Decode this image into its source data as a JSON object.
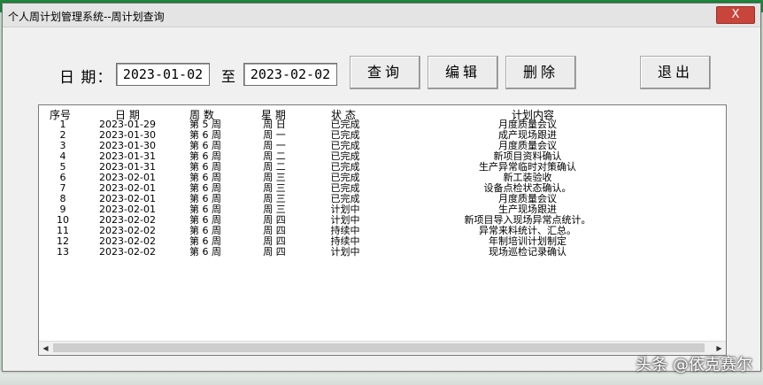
{
  "window": {
    "title": "个人周计划管理系统--周计划查询",
    "close_label": "X"
  },
  "filter": {
    "date_label": "日 期：",
    "start_date": "2023-01-02",
    "to_label": "至",
    "end_date": "2023-02-02"
  },
  "buttons": {
    "query": "查询",
    "edit": "编辑",
    "delete": "删除",
    "exit": "退出"
  },
  "table": {
    "headers": {
      "seq": "序号",
      "date": "日 期",
      "week": "周 数",
      "weekday": "星 期",
      "status": "状 态",
      "content": "计划内容"
    },
    "rows": [
      {
        "seq": "1",
        "date": "2023-01-29",
        "week": "第 5 周",
        "weekday": "周 日",
        "status": "已完成",
        "content": "月度质量会议"
      },
      {
        "seq": "2",
        "date": "2023-01-30",
        "week": "第 6 周",
        "weekday": "周 一",
        "status": "已完成",
        "content": "成产现场跟进"
      },
      {
        "seq": "3",
        "date": "2023-01-30",
        "week": "第 6 周",
        "weekday": "周 一",
        "status": "已完成",
        "content": "月度质量会议"
      },
      {
        "seq": "4",
        "date": "2023-01-31",
        "week": "第 6 周",
        "weekday": "周 二",
        "status": "已完成",
        "content": "新项目资料确认"
      },
      {
        "seq": "5",
        "date": "2023-01-31",
        "week": "第 6 周",
        "weekday": "周 二",
        "status": "已完成",
        "content": "生产异常临时对策确认"
      },
      {
        "seq": "6",
        "date": "2023-02-01",
        "week": "第 6 周",
        "weekday": "周 三",
        "status": "已完成",
        "content": "新工装验收"
      },
      {
        "seq": "7",
        "date": "2023-02-01",
        "week": "第 6 周",
        "weekday": "周 三",
        "status": "已完成",
        "content": "设备点检状态确认。"
      },
      {
        "seq": "8",
        "date": "2023-02-01",
        "week": "第 6 周",
        "weekday": "周 三",
        "status": "已完成",
        "content": "月度质量会议"
      },
      {
        "seq": "9",
        "date": "2023-02-01",
        "week": "第 6 周",
        "weekday": "周 三",
        "status": "计划中",
        "content": "生产现场跟进"
      },
      {
        "seq": "10",
        "date": "2023-02-02",
        "week": "第 6 周",
        "weekday": "周 四",
        "status": "计划中",
        "content": "新项目导入现场异常点统计。"
      },
      {
        "seq": "11",
        "date": "2023-02-02",
        "week": "第 6 周",
        "weekday": "周 四",
        "status": "持续中",
        "content": "异常来料统计、汇总。"
      },
      {
        "seq": "12",
        "date": "2023-02-02",
        "week": "第 6 周",
        "weekday": "周 四",
        "status": "持续中",
        "content": "年制培训计划制定"
      },
      {
        "seq": "13",
        "date": "2023-02-02",
        "week": "第 6 周",
        "weekday": "周 四",
        "status": "计划中",
        "content": "现场巡检记录确认"
      }
    ]
  },
  "scrollbar": {
    "left_arrow": "◀",
    "right_arrow": "▶"
  },
  "watermark": "头条 @依克赛尔"
}
